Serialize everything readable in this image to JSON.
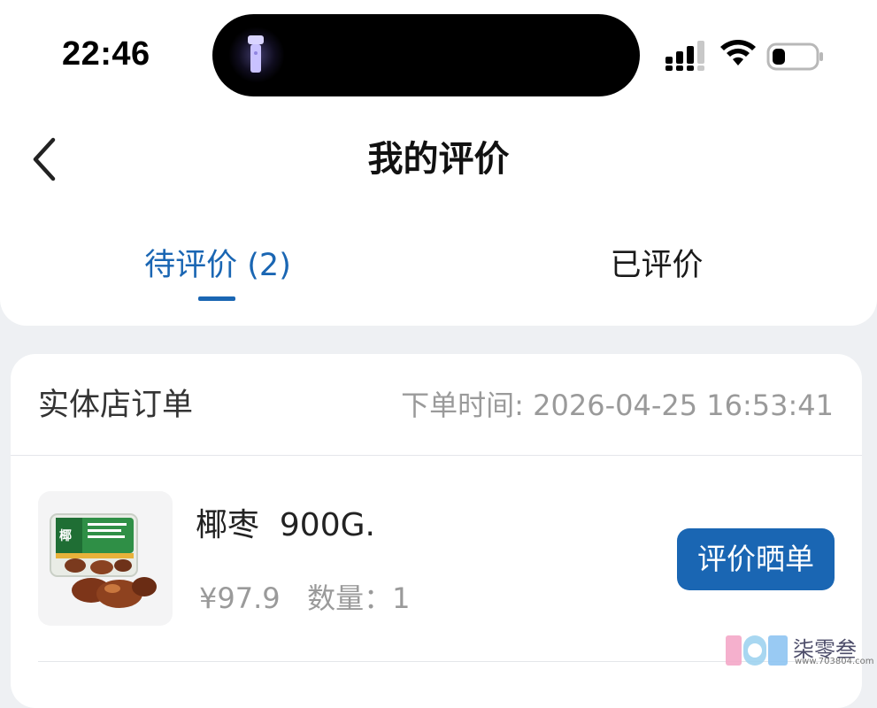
{
  "status_bar": {
    "time": "22:46",
    "icons": [
      "flashlight-icon",
      "cellular-signal-icon",
      "wifi-icon",
      "battery-icon"
    ]
  },
  "nav": {
    "back_icon": "chevron-left-icon",
    "title": "我的评价"
  },
  "tabs": [
    {
      "label": "待评价 (2)",
      "active": true
    },
    {
      "label": "已评价",
      "active": false
    }
  ],
  "order": {
    "store_label": "实体店订单",
    "order_time": "下单时间: 2026-04-25 16:53:41",
    "product": {
      "name": "椰枣  900G.",
      "price_qty": "¥97.9   数量：1",
      "image_icon": "dates-product-image"
    },
    "action_label": "评价晒单"
  },
  "watermark": {
    "logo_text": "TOB",
    "text": "柒零叁",
    "url": "www.703804.com"
  },
  "colors": {
    "accent": "#1a66b3",
    "page_background": "#eef0f3",
    "card_background": "#ffffff",
    "muted_text": "#9a9a9a"
  }
}
